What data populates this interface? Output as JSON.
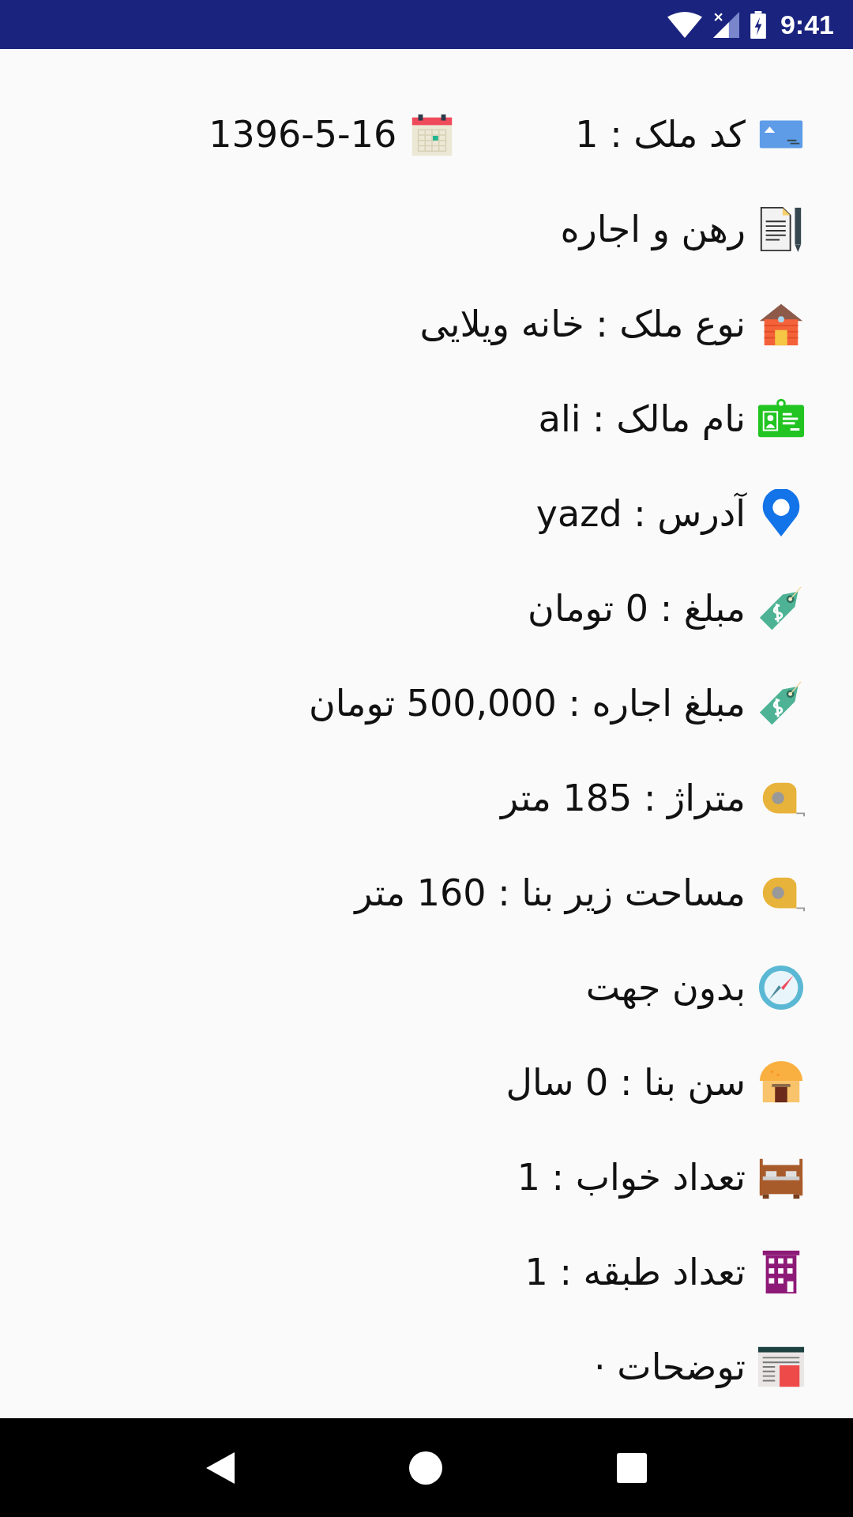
{
  "status_bar": {
    "time": "9:41"
  },
  "header": {
    "code": "کد ملک : 1",
    "date": "1396-5-16"
  },
  "rows": [
    {
      "kind": "contract",
      "text": "رهن و اجاره"
    },
    {
      "kind": "house",
      "text": "نوع ملک : خانه ویلایی"
    },
    {
      "kind": "owner",
      "text": "نام مالک : ali"
    },
    {
      "kind": "address",
      "text": "آدرس : yazd"
    },
    {
      "kind": "price",
      "text": "مبلغ : 0 تومان"
    },
    {
      "kind": "price",
      "text": "مبلغ اجاره : 500,000 تومان"
    },
    {
      "kind": "area",
      "text": "متراژ : 185 متر"
    },
    {
      "kind": "area",
      "text": "مساحت زیر بنا : 160 متر"
    },
    {
      "kind": "direction",
      "text": "بدون جهت"
    },
    {
      "kind": "age",
      "text": "سن بنا : 0 سال"
    },
    {
      "kind": "bedrooms",
      "text": "تعداد خواب : 1"
    },
    {
      "kind": "floors",
      "text": "تعداد طبقه : 1"
    },
    {
      "kind": "description",
      "text": "توضحات ·"
    }
  ]
}
